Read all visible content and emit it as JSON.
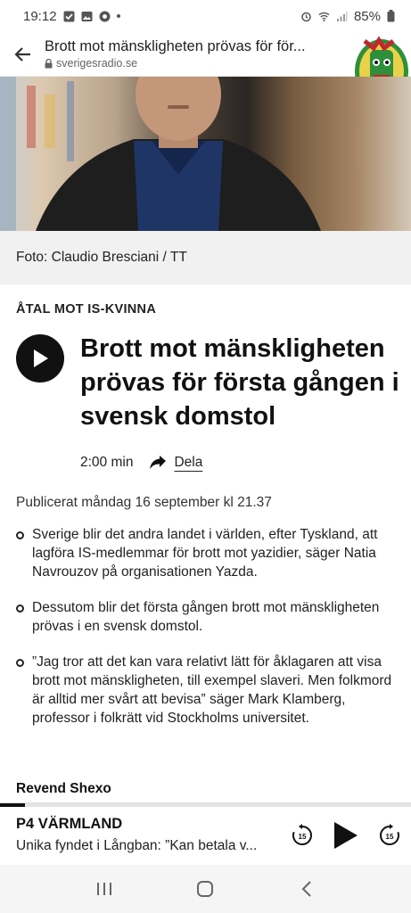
{
  "status_bar": {
    "time": "19:12",
    "battery": "85%",
    "left_icons": [
      "check-box-icon",
      "image-icon",
      "chrome-icon",
      "dot-icon"
    ],
    "right_icons": [
      "alarm-icon",
      "wifi-icon",
      "signal-icon",
      "battery-icon"
    ]
  },
  "browser": {
    "title": "Brott mot mänskligheten prövas för för...",
    "url": "sverigesradio.se"
  },
  "article": {
    "photo_credit": "Foto: Claudio Bresciani / TT",
    "kicker": "ÅTAL MOT IS-KVINNA",
    "headline": "Brott mot mänskligheten prövas för första gången i svensk domstol",
    "duration": "2:00 min",
    "share_label": "Dela",
    "published": "Publicerat måndag 16 september kl 21.37",
    "bullets": [
      "Sverige blir det andra landet i världen, efter Tyskland, att lagföra IS-medlemmar för brott mot yazidier, säger Natia Navrouzov på organisationen Yazda.",
      "Dessutom blir det första gången brott mot mänskligheten prövas i en svensk domstol.",
      "”Jag tror att det kan vara relativt lätt för åklagaren att visa brott mot mänskligheten, till exempel slaveri. Men folkmord är alltid mer svårt att bevisa” säger Mark Klamberg, professor i folkrätt vid Stockholms universitet."
    ],
    "author": "Revend Shexo"
  },
  "player": {
    "channel": "P4 VÄRMLAND",
    "episode": "Unika fyndet i Långban: ”Kan betala v...",
    "skip_back": "15",
    "skip_forward": "15",
    "progress": 0.06
  },
  "colors": {
    "text": "#111111",
    "caption_bg": "#f1f1f1",
    "navbar_bg": "#f5f5f5"
  }
}
